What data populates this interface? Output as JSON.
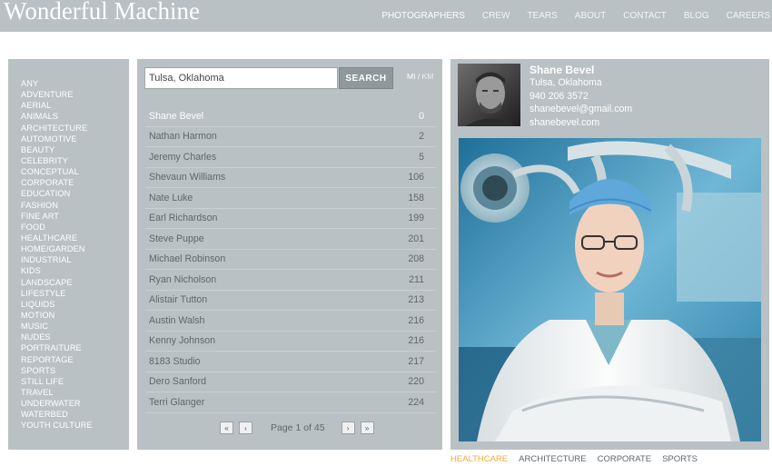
{
  "header": {
    "logo": "Wonderful Machine",
    "nav": [
      {
        "label": "PHOTOGRAPHERS",
        "active": true
      },
      {
        "label": "CREW"
      },
      {
        "label": "TEARS"
      },
      {
        "label": "ABOUT"
      },
      {
        "label": "CONTACT"
      },
      {
        "label": "BLOG"
      },
      {
        "label": "CAREERS"
      }
    ]
  },
  "categories": [
    "ANY",
    "ADVENTURE",
    "AERIAL",
    "ANIMALS",
    "ARCHITECTURE",
    "AUTOMOTIVE",
    "BEAUTY",
    "CELEBRITY",
    "CONCEPTUAL",
    "CORPORATE",
    "EDUCATION",
    "FASHION",
    "FINE ART",
    "FOOD",
    "HEALTHCARE",
    "HOME/GARDEN",
    "INDUSTRIAL",
    "KIDS",
    "LANDSCAPE",
    "LIFESTYLE",
    "LIQUIDS",
    "MOTION",
    "MUSIC",
    "NUDES",
    "PORTRAITURE",
    "REPORTAGE",
    "SPORTS",
    "STILL LIFE",
    "TRAVEL",
    "UNDERWATER",
    "WATERBED",
    "YOUTH CULTURE"
  ],
  "search": {
    "value": "Tulsa, Oklahoma",
    "button": "SEARCH",
    "unit_mi": "MI",
    "unit_sep": " / ",
    "unit_km": "KM"
  },
  "results": [
    {
      "name": "Shane Bevel",
      "distance": "0"
    },
    {
      "name": "Nathan Harmon",
      "distance": "2"
    },
    {
      "name": "Jeremy Charles",
      "distance": "5"
    },
    {
      "name": "Shevaun Williams",
      "distance": "106"
    },
    {
      "name": "Nate Luke",
      "distance": "158"
    },
    {
      "name": "Earl Richardson",
      "distance": "199"
    },
    {
      "name": "Steve Puppe",
      "distance": "201"
    },
    {
      "name": "Michael Robinson",
      "distance": "208"
    },
    {
      "name": "Ryan Nicholson",
      "distance": "211"
    },
    {
      "name": "Alistair Tutton",
      "distance": "213"
    },
    {
      "name": "Austin Walsh",
      "distance": "216"
    },
    {
      "name": "Kenny Johnson",
      "distance": "216"
    },
    {
      "name": "8183 Studio",
      "distance": "217"
    },
    {
      "name": "Dero Sanford",
      "distance": "220"
    },
    {
      "name": "Terri Glanger",
      "distance": "224"
    }
  ],
  "pager": {
    "first": "«",
    "prev": "‹",
    "label": "Page 1 of 45",
    "next": "›",
    "last": "»"
  },
  "profile": {
    "name": "Shane Bevel",
    "location": "Tulsa, Oklahoma",
    "phone": "940 206 3572",
    "email": "shanebevel@gmail.com",
    "website": "shanebevel.com"
  },
  "portfolio_tags": [
    {
      "label": "HEALTHCARE",
      "active": true
    },
    {
      "label": "ARCHITECTURE"
    },
    {
      "label": "CORPORATE"
    },
    {
      "label": "SPORTS"
    }
  ],
  "colors": {
    "panel": "#b9c1c4",
    "accent": "#f2a93b"
  }
}
